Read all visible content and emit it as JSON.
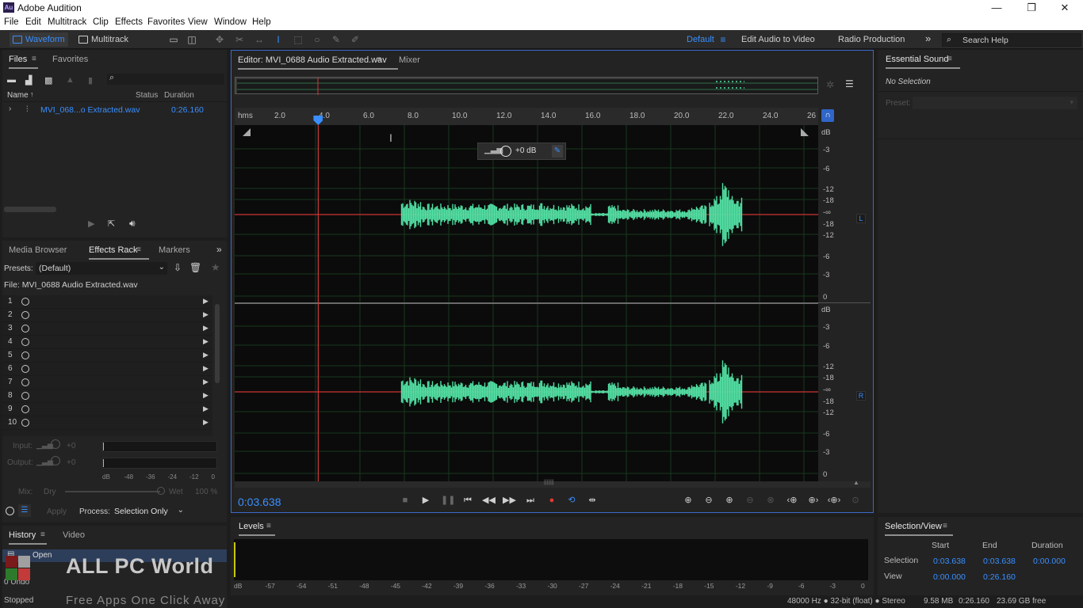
{
  "app": {
    "title": "Adobe Audition",
    "logo_text": "Au",
    "window_buttons": [
      "—",
      "❐",
      "✕"
    ]
  },
  "menu": [
    "File",
    "Edit",
    "Multitrack",
    "Clip",
    "Effects",
    "Favorites",
    "View",
    "Window",
    "Help"
  ],
  "toolbar": {
    "waveform_label": "Waveform",
    "multitrack_label": "Multitrack",
    "workspaces": [
      "Default",
      "Edit Audio to Video",
      "Radio Production"
    ],
    "more_label": "»",
    "search_placeholder": "Search Help"
  },
  "files_panel": {
    "tabs": [
      "Files",
      "Favorites"
    ],
    "columns": [
      "Name",
      "Status",
      "Duration"
    ],
    "items": [
      {
        "name": "MVI_068...o Extracted.wav",
        "duration": "0:26.160"
      }
    ]
  },
  "editor": {
    "tabs": [
      "Editor: MVI_0688 Audio Extracted.wav",
      "Mixer"
    ],
    "ruler_unit": "hms",
    "ruler_ticks": [
      "2.0",
      "4.0",
      "6.0",
      "8.0",
      "10.0",
      "12.0",
      "14.0",
      "16.0",
      "18.0",
      "20.0",
      "22.0",
      "24.0",
      "26"
    ],
    "db_scale_top": [
      "dB",
      "-3",
      "-6",
      "-12",
      "-18",
      "-∞",
      "-18",
      "-12",
      "-6",
      "-3",
      "0"
    ],
    "db_scale_bottom": [
      "dB",
      "-3",
      "-6",
      "-12",
      "-18",
      "-∞",
      "-18",
      "-12",
      "-6",
      "-3",
      "0"
    ],
    "channel_left": "L",
    "channel_right": "R",
    "hud_gain": "+0 dB",
    "current_time": "0:03.638",
    "playhead_fraction": 0.1391,
    "waveform_color": "#52e0a4",
    "selection_color": "#cc3333"
  },
  "essential_sound": {
    "title": "Essential Sound",
    "no_selection": "No Selection",
    "preset_label": "Preset:"
  },
  "effects_rack": {
    "tabs": [
      "Media Browser",
      "Effects Rack",
      "Markers"
    ],
    "presets_label": "Presets:",
    "preset_value": "(Default)",
    "file_label": "File: MVI_0688 Audio Extracted.wav",
    "slots": [
      "1",
      "2",
      "3",
      "4",
      "5",
      "6",
      "7",
      "8",
      "9",
      "10"
    ],
    "input_label": "Input:",
    "output_label": "Output:",
    "input_gain": "+0",
    "output_gain": "+0",
    "meter_scale": [
      "dB",
      "-48",
      "-36",
      "-24",
      "-12",
      "0"
    ],
    "mix_label": "Mix:",
    "dry_label": "Dry",
    "wet_label": "Wet",
    "mix_value": "100 %",
    "apply_label": "Apply",
    "process_label": "Process:",
    "process_value": "Selection Only"
  },
  "history_panel": {
    "tabs": [
      "History",
      "Video"
    ],
    "items": [
      "Open"
    ],
    "undo_count": "0 Undo",
    "status": "Stopped"
  },
  "watermark": {
    "title": "ALL PC World",
    "subtitle": "Free Apps One Click Away"
  },
  "levels": {
    "title": "Levels",
    "scale": [
      "dB",
      "-57",
      "-54",
      "-51",
      "-48",
      "-45",
      "-42",
      "-39",
      "-36",
      "-33",
      "-30",
      "-27",
      "-24",
      "-21",
      "-18",
      "-15",
      "-12",
      "-9",
      "-6",
      "-3",
      "0"
    ]
  },
  "selection_view": {
    "title": "Selection/View",
    "columns": [
      "Start",
      "End",
      "Duration"
    ],
    "rows": [
      {
        "label": "Selection",
        "start": "0:03.638",
        "end": "0:03.638",
        "duration": "0:00.000"
      },
      {
        "label": "View",
        "start": "0:00.000",
        "end": "0:26.160",
        "duration": ""
      }
    ]
  },
  "status_bar": {
    "format": "48000 Hz ● 32-bit (float) ● Stereo",
    "file_size": "9.58 MB",
    "duration": "0:26.160",
    "free_space": "23.69 GB free"
  }
}
